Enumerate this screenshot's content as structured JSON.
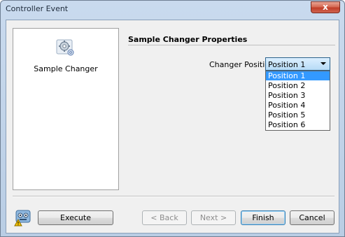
{
  "window": {
    "title": "Controller Event",
    "close_glyph": "x"
  },
  "sidebar": {
    "item_label": "Sample Changer",
    "icon": "gear-icon"
  },
  "main": {
    "section_title": "Sample Changer Properties",
    "changer_position_label": "Changer Position:",
    "changer_position_value": "Position 1",
    "options": [
      "Position 1",
      "Position 2",
      "Position 3",
      "Position 4",
      "Position 5",
      "Position 6"
    ]
  },
  "footer": {
    "execute_label": "Execute",
    "back_label": "< Back",
    "next_label": "Next >",
    "finish_label": "Finish",
    "cancel_label": "Cancel"
  }
}
